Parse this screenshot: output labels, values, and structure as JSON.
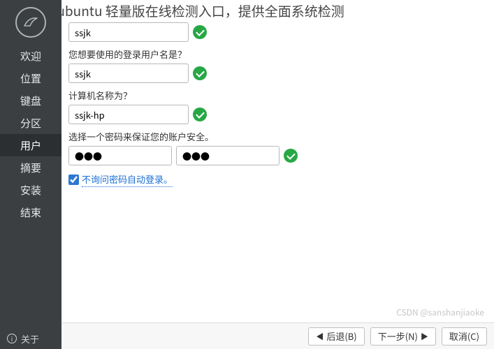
{
  "topbar": {
    "title": "lubuntu 轻量版在线检测入口，提供全面系统检测"
  },
  "sidebar": {
    "items": [
      {
        "label": "欢迎"
      },
      {
        "label": "位置"
      },
      {
        "label": "键盘"
      },
      {
        "label": "分区"
      },
      {
        "label": "用户"
      },
      {
        "label": "摘要"
      },
      {
        "label": "安装"
      },
      {
        "label": "结束"
      }
    ],
    "about": "关于"
  },
  "form": {
    "name_value": "ssjk",
    "login_label": "您想要使用的登录用户名是？",
    "login_value": "ssjk",
    "hostname_label": "计算机名称为？",
    "hostname_value": "ssjk-hp",
    "password_label": "选择一个密码来保证您的账户安全。",
    "password_value": "●●●",
    "password_confirm_value": "●●●",
    "autologin_label": "不询问密码自动登录。"
  },
  "footer": {
    "back": "后退(B)",
    "next": "下一步(N)",
    "cancel": "取消(C)"
  },
  "watermark": "CSDN @sanshanjiaoke"
}
